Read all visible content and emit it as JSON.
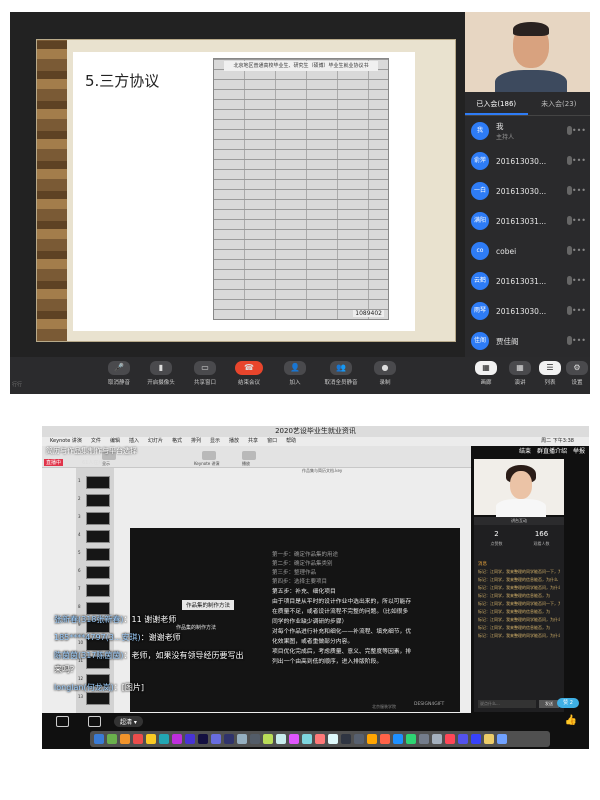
{
  "meeting": {
    "slide_title": "5.三方协议",
    "doc_heading": "北京地区普通高校毕业生、研究生（硕博）毕业生就业协议书",
    "doc_number": "1089402",
    "participants_tab_joined": "已入会(186)",
    "participants_tab_not_joined": "未入会(23)",
    "participants": [
      {
        "avatar": "我",
        "name": "我",
        "sub": "主持人"
      },
      {
        "avatar": "俞萍",
        "name": "201613030...",
        "sub": ""
      },
      {
        "avatar": "一白",
        "name": "201613030...",
        "sub": ""
      },
      {
        "avatar": "满阳",
        "name": "201613031...",
        "sub": ""
      },
      {
        "avatar": "co",
        "name": "cobei",
        "sub": ""
      },
      {
        "avatar": "云鹤",
        "name": "201613031...",
        "sub": ""
      },
      {
        "avatar": "雨琴",
        "name": "201613030...",
        "sub": ""
      },
      {
        "avatar": "佳阁",
        "name": "贾佳阁",
        "sub": ""
      }
    ],
    "toolbar": {
      "left_stub": "行行",
      "unmute": "取消静音",
      "camera": "开启摄像头",
      "share": "共享窗口",
      "end": "结束会议",
      "join": "加入",
      "mute_all": "取消全员静音",
      "record": "录制",
      "view_gallery": "画廊",
      "view_speaker": "演讲",
      "view_list": "列表",
      "settings": "设置"
    }
  },
  "recording": {
    "window_title": "2020艺设毕业生就业资讯",
    "menubar": [
      "Keynote 讲演",
      "文件",
      "编辑",
      "插入",
      "幻灯片",
      "格式",
      "排列",
      "显示",
      "播放",
      "共享",
      "窗口",
      "帮助"
    ],
    "menubar_right": "周二 下午3:38",
    "course_title": "简历与作品集制作与平台选择",
    "live_badge": "直播中",
    "desc": "61人在线",
    "top_links": [
      "结束",
      "群直播介绍",
      "举报"
    ],
    "keynote_labels": [
      "显示",
      "Keynote 讲演",
      "播放"
    ],
    "keynote_file": "作品集与简历文档.key",
    "slide_numbers": [
      "1",
      "2",
      "3",
      "4",
      "5",
      "6",
      "7",
      "8",
      "9",
      "10",
      "11",
      "12",
      "13"
    ],
    "slide_left_title": "作品集的制作方法",
    "slide_steps": [
      "第一步：确定作品集的用途",
      "第二步：确定作品集类别",
      "第三步：整理作品",
      "第四步：选择主要项目"
    ],
    "slide_body": [
      "第五步：补充、细化项目",
      "由于项目是从平时的设计作业中选出来的，所以可能存",
      "在质量不足，或者设计流程不完整的问题。（比如很多",
      "同学的作业缺少调研的步骤）",
      "对每个作品进行补充和细化——补流程、填充细节，优",
      "化效果图，或者重做部分内容。",
      "项目优化完成后，考虑质量、意义、完整度等因素，排",
      "列出一个由高到低的顺序，进入排版阶段。"
    ],
    "logo_text": "北京服装学院",
    "logo_text2": "DESIGN4GIFT",
    "stats": [
      {
        "n": "2",
        "l": "点赞数"
      },
      {
        "n": "166",
        "l": "观看人数"
      }
    ],
    "panel_header": "讲台互动",
    "chat_header": "消息",
    "chat_lines": [
      "标记：江同学，我来整理的同学能否问一下，为",
      "标记：江同学，我来整理的信息能否，为什么",
      "标记：江同学，我来整理的同学能否问，为什么呢",
      "标记：江同学，我来整理的信息能否，为",
      "标记：江同学，我来整理的同学能否问一下，为什么呢",
      "标记：江同学，我来整理的信息能否，为",
      "标记：江同学，我来整理的同学能否问，为什么",
      "标记：江同学，我来整理的信息能否，为",
      "标记：江同学，我来整理的同学能否问，为什么呢"
    ],
    "chat_input_placeholder": "说点什么...",
    "chat_send": "发送",
    "like_count": "赞 2",
    "overlay_caption": "作品集的制作方法",
    "danmu": [
      {
        "user": "张新春(318张新春)",
        "text": "：11 谢谢老师"
      },
      {
        "user": "185****4797(3...安琪)",
        "text": "：谢谢老师"
      },
      {
        "user": "陈茵茵(317陈茵茵)",
        "text": "：老师，如果没有领导经历要写出"
      },
      {
        "user": "",
        "text": "来吗？"
      },
      {
        "user": "longlan(何龙岚)",
        "text": "：[图片]"
      }
    ],
    "quality": "超清 ▾"
  }
}
